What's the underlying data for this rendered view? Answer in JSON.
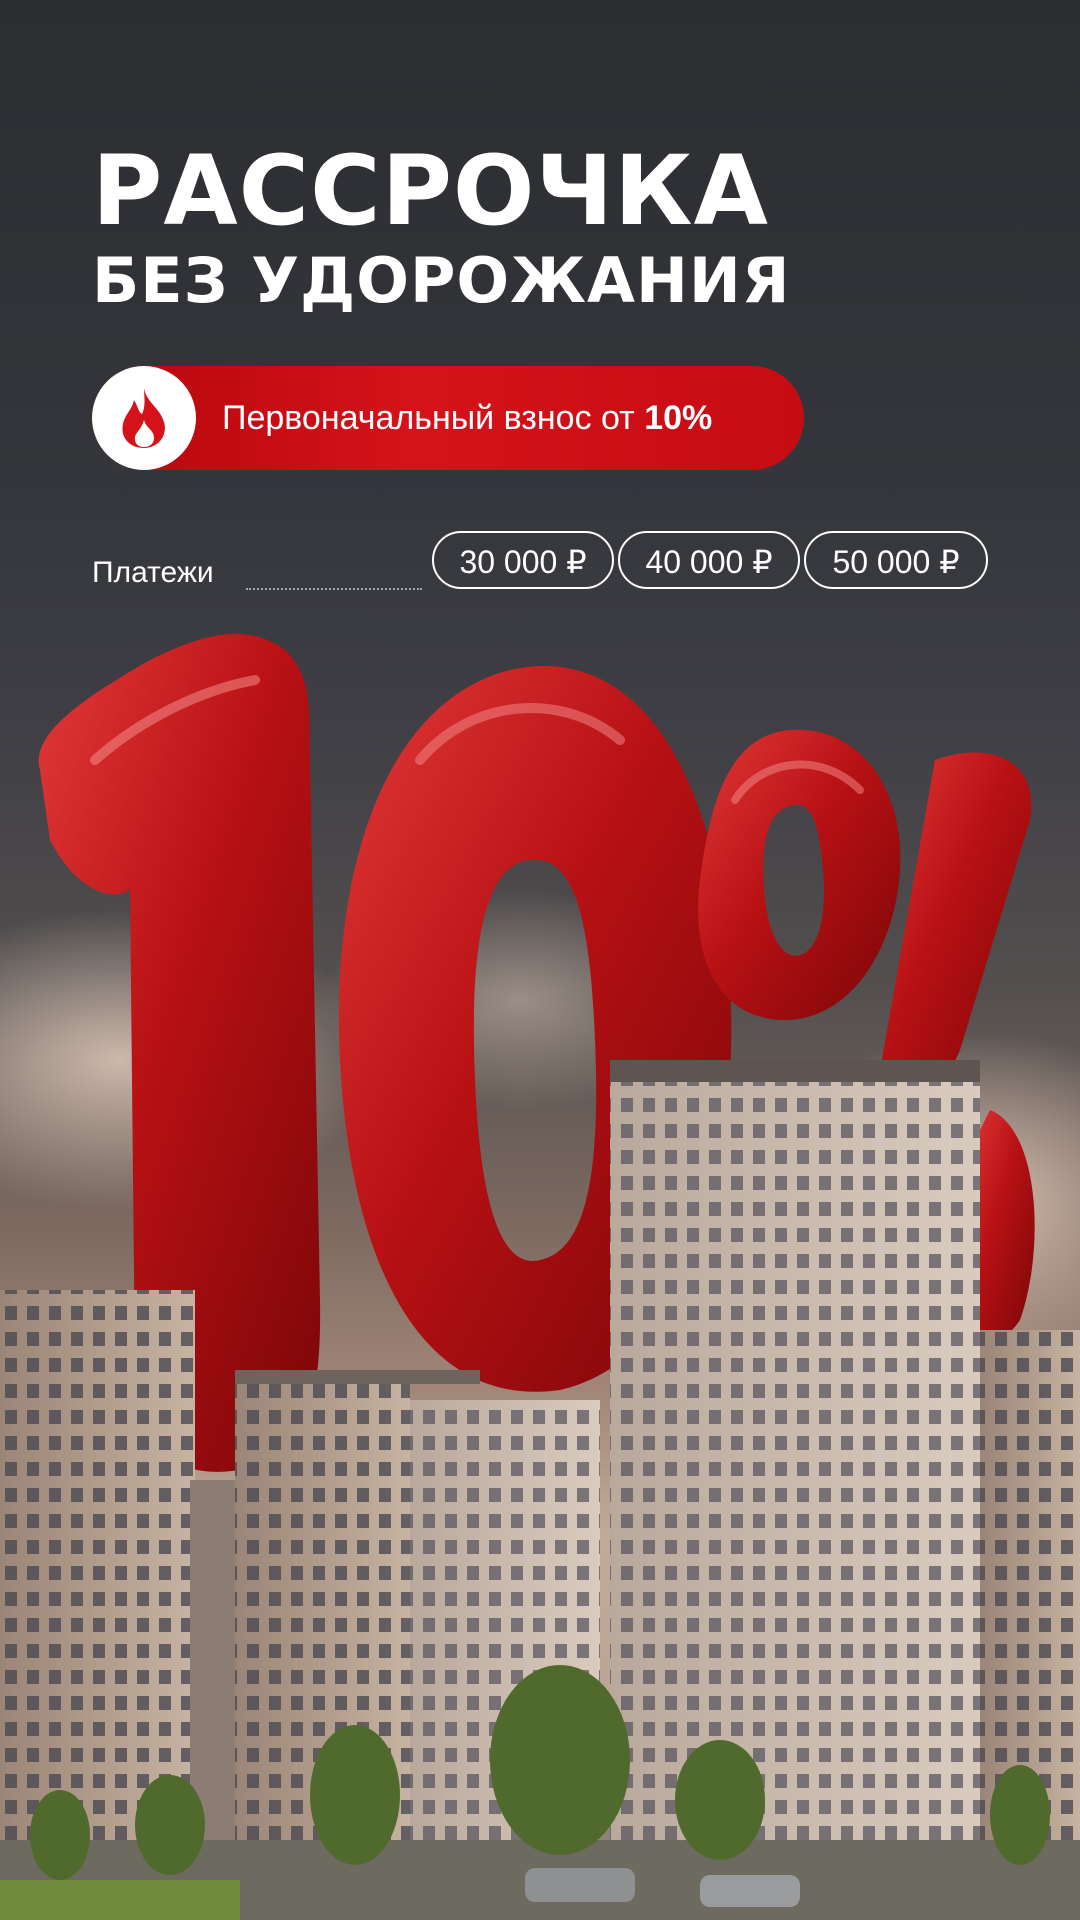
{
  "headline": {
    "line1": "Рассрочка",
    "line2": "без удорожания"
  },
  "offer": {
    "icon": "flame-icon",
    "text": "Первоначальный взнос от ",
    "highlight": "10%"
  },
  "payments": {
    "label": "Платежи",
    "options": [
      "30 000 ₽",
      "40 000 ₽",
      "50 000 ₽"
    ]
  },
  "colors": {
    "accent_red": "#d5121a",
    "text": "#ffffff",
    "background_dark": "#2b2d31"
  }
}
